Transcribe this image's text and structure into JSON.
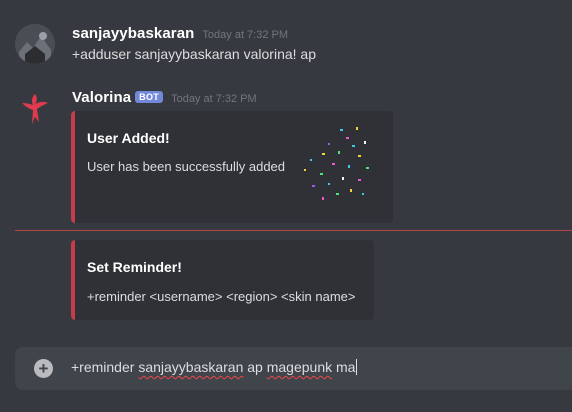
{
  "messages": [
    {
      "author": "sanjayybaskaran",
      "timestamp": "Today at 7:32 PM",
      "content": "+adduser sanjayybaskaran valorina! ap"
    },
    {
      "author": "Valorina",
      "badge": "BOT",
      "timestamp": "Today at 7:32 PM",
      "embeds": [
        {
          "title": "User Added!",
          "description": "User has been successfully added",
          "color": "#c53d4a",
          "thumbnail": "confetti-image"
        },
        {
          "title": "Set Reminder!",
          "description": "+reminder <username> <region> <skin name>",
          "color": "#c53d4a"
        }
      ]
    }
  ],
  "composer": {
    "add_icon": "plus-circle-icon",
    "text_prefix": "+reminder ",
    "text_misspelled_1": "sanjayybaskaran",
    "text_middle": " ap ",
    "text_misspelled_2": "magepunk",
    "text_suffix": " ma"
  },
  "colors": {
    "background": "#36393f",
    "embed_background": "#2f3136",
    "embed_accent": "#c53d4a",
    "bot_badge": "#7289da",
    "new_message_divider": "#f04747"
  }
}
